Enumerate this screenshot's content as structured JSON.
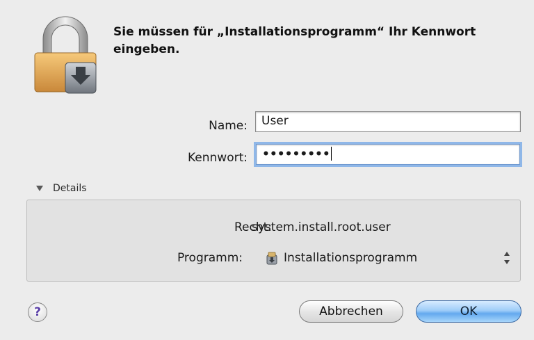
{
  "dialog": {
    "message": "Sie müssen für „Installationsprogramm“ Ihr Kennwort eingeben."
  },
  "form": {
    "name_label": "Name:",
    "name_value": "User",
    "password_label": "Kennwort:",
    "password_value": "•••••••••"
  },
  "details": {
    "toggle_label": "Details",
    "right_label": "Recht:",
    "right_value": "system.install.root.user",
    "program_label": "Programm:",
    "program_value": "Installationsprogramm"
  },
  "buttons": {
    "help": "?",
    "cancel": "Abbrechen",
    "ok": "OK"
  },
  "colors": {
    "accent": "#63a9ee",
    "focus_ring": "#8fb7e8",
    "help_glyph": "#5a3fa8"
  },
  "icons": {
    "lock": "lock-icon",
    "installer": "installer-icon",
    "disclosure": "disclosure-triangle-icon",
    "stepper": "stepper-icon"
  }
}
